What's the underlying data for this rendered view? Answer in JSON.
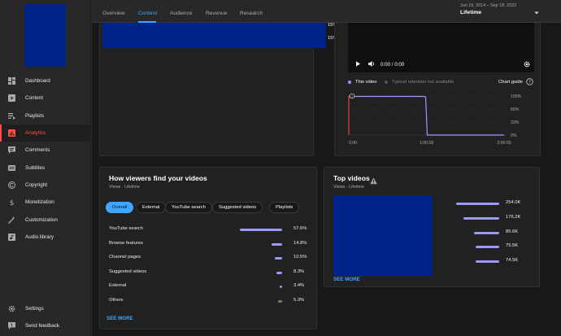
{
  "sidebar": {
    "items": [
      {
        "label": "Dashboard",
        "icon": "dashboard-icon"
      },
      {
        "label": "Content",
        "icon": "content-icon"
      },
      {
        "label": "Playlists",
        "icon": "playlists-icon"
      },
      {
        "label": "Analytics",
        "icon": "analytics-icon",
        "active": true
      },
      {
        "label": "Comments",
        "icon": "comments-icon"
      },
      {
        "label": "Subtitles",
        "icon": "subtitles-icon"
      },
      {
        "label": "Copyright",
        "icon": "copyright-icon"
      },
      {
        "label": "Monetization",
        "icon": "monetization-icon"
      },
      {
        "label": "Customization",
        "icon": "customization-icon"
      },
      {
        "label": "Audio library",
        "icon": "audio-library-icon"
      }
    ],
    "bottom": [
      {
        "label": "Settings",
        "icon": "gear-icon"
      },
      {
        "label": "Send feedback",
        "icon": "feedback-icon"
      }
    ]
  },
  "header": {
    "tabs": [
      "Overview",
      "Content",
      "Audience",
      "Revenue",
      "Research"
    ],
    "active_tab": "Content",
    "date_range": "Jun 19, 2014 – Sep 18, 2022",
    "period": "Lifetime"
  },
  "video_panel": {
    "pct_top": "15%",
    "pct_bottom": "15%"
  },
  "retention": {
    "time_display": "0:00 / 0:00",
    "legend_this_video": "This video",
    "legend_typical": "Typical retention not available",
    "chart_guide": "Chart guide",
    "marker": "i"
  },
  "viewers": {
    "title": "How viewers find your videos",
    "subtitle": "Views · Lifetime",
    "chips": [
      "Overall",
      "External",
      "YouTube search",
      "Suggested videos",
      "Playlists"
    ],
    "rows": [
      {
        "label": "YouTube search",
        "value": "57.6%",
        "fraction": 0.576
      },
      {
        "label": "Browse features",
        "value": "14.8%",
        "fraction": 0.148
      },
      {
        "label": "Channel pages",
        "value": "10.5%",
        "fraction": 0.105
      },
      {
        "label": "Suggested videos",
        "value": "8.3%",
        "fraction": 0.083
      },
      {
        "label": "External",
        "value": "3.4%",
        "fraction": 0.034
      },
      {
        "label": "Others",
        "value": "5.3%",
        "fraction": 0.053
      }
    ],
    "see_more": "SEE MORE"
  },
  "top_videos": {
    "title": "Top videos",
    "subtitle": "Views · Lifetime",
    "rows": [
      {
        "value": "254.0K",
        "views": 254000
      },
      {
        "value": "176.2K",
        "views": 176200
      },
      {
        "value": "85.6K",
        "views": 85600
      },
      {
        "value": "75.5K",
        "views": 75500
      },
      {
        "value": "74.5K",
        "views": 74500
      }
    ],
    "see_more": "SEE MORE"
  },
  "chart_data": {
    "type": "line",
    "x": [
      "0:00",
      "0:06",
      "0:12",
      "0:20",
      "0:28",
      "0:29",
      "0:30",
      "1:00",
      "1:00:28",
      "1:00:29",
      "2:00:55"
    ],
    "series": [
      {
        "values": [
          100,
          99,
          99,
          99,
          99,
          99,
          99,
          99,
          98,
          0,
          0
        ]
      }
    ],
    "x_ticks": [
      "0:00",
      "1:00:28",
      "2:00:55"
    ],
    "y_ticks": [
      "100%",
      "66%",
      "33%",
      "0%"
    ],
    "ylim": [
      0,
      100
    ],
    "grid": true,
    "colors": {
      "line": "#9c97ff",
      "start": "#ff4e45"
    }
  },
  "colors": {
    "accent": "#3ea6ff",
    "analytics": "#ff4e45",
    "bar": "#9c97ff",
    "thumb": "#002289"
  }
}
